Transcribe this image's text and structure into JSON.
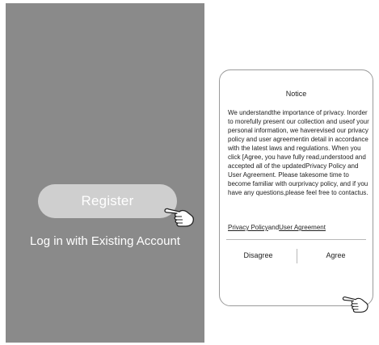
{
  "left_screen": {
    "register_label": "Register",
    "login_label": "Log in  with Existing Account"
  },
  "notice": {
    "title": "Notice",
    "body": "We understandthe importance of privacy. Inorder to morefully present our collection and useof your personal information, we haverevised our privacy policy and user agreementin detail in accordance with the latest laws and regulations. When you click [Agree, you have fully read,understood and accepted all of the updatedPrivacy Policy and User Agreement. Please takesome time to become familiar with ourprivacy policy, and if you have any questions,please feel free to contactus.",
    "privacy_policy_label": "Privacy Policy",
    "and_label": "and",
    "user_agreement_label": "User Agreement",
    "disagree_label": "Disagree",
    "agree_label": "Agree"
  },
  "icons": {
    "hand": "pointing-hand-icon"
  },
  "colors": {
    "phone_background": "#8a8a8a",
    "register_button": "#cfcfcf",
    "text_on_dark": "#ffffff"
  }
}
